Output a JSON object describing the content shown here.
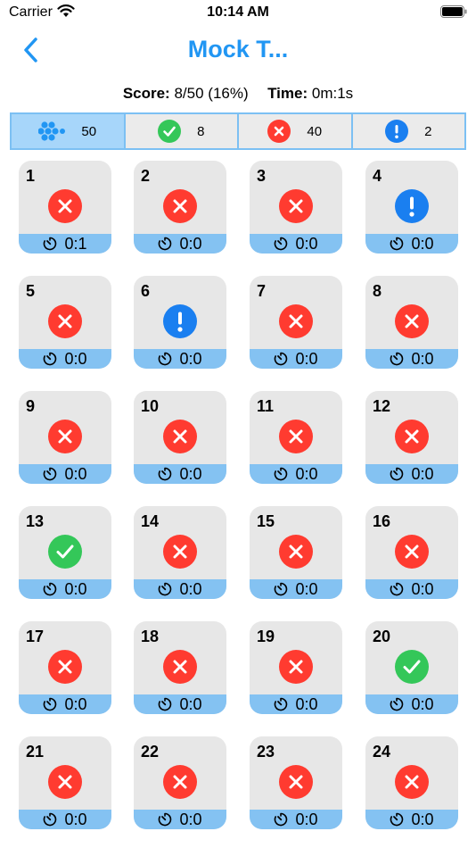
{
  "status_bar": {
    "carrier": "Carrier",
    "time": "10:14 AM"
  },
  "nav": {
    "title": "Mock T..."
  },
  "summary": {
    "score_label": "Score:",
    "score_value": "8/50 (16%)",
    "time_label": "Time:",
    "time_value": "0m:1s"
  },
  "filters": [
    {
      "icon": "all-dots-icon",
      "count": "50",
      "active": true
    },
    {
      "icon": "correct-icon",
      "count": "8",
      "active": false
    },
    {
      "icon": "wrong-icon",
      "count": "40",
      "active": false
    },
    {
      "icon": "skipped-icon",
      "count": "2",
      "active": false
    }
  ],
  "colors": {
    "accent": "#2196f3",
    "correct": "#34c759",
    "wrong": "#ff3b30",
    "skipped": "#1a7ff0",
    "card_bg": "#e7e7e7",
    "card_footer": "#84c2f2"
  },
  "questions": [
    {
      "number": "1",
      "status": "wrong",
      "time": "0:1"
    },
    {
      "number": "2",
      "status": "wrong",
      "time": "0:0"
    },
    {
      "number": "3",
      "status": "wrong",
      "time": "0:0"
    },
    {
      "number": "4",
      "status": "skipped",
      "time": "0:0"
    },
    {
      "number": "5",
      "status": "wrong",
      "time": "0:0"
    },
    {
      "number": "6",
      "status": "skipped",
      "time": "0:0"
    },
    {
      "number": "7",
      "status": "wrong",
      "time": "0:0"
    },
    {
      "number": "8",
      "status": "wrong",
      "time": "0:0"
    },
    {
      "number": "9",
      "status": "wrong",
      "time": "0:0"
    },
    {
      "number": "10",
      "status": "wrong",
      "time": "0:0"
    },
    {
      "number": "11",
      "status": "wrong",
      "time": "0:0"
    },
    {
      "number": "12",
      "status": "wrong",
      "time": "0:0"
    },
    {
      "number": "13",
      "status": "correct",
      "time": "0:0"
    },
    {
      "number": "14",
      "status": "wrong",
      "time": "0:0"
    },
    {
      "number": "15",
      "status": "wrong",
      "time": "0:0"
    },
    {
      "number": "16",
      "status": "wrong",
      "time": "0:0"
    },
    {
      "number": "17",
      "status": "wrong",
      "time": "0:0"
    },
    {
      "number": "18",
      "status": "wrong",
      "time": "0:0"
    },
    {
      "number": "19",
      "status": "wrong",
      "time": "0:0"
    },
    {
      "number": "20",
      "status": "correct",
      "time": "0:0"
    },
    {
      "number": "21",
      "status": "wrong",
      "time": "0:0"
    },
    {
      "number": "22",
      "status": "wrong",
      "time": "0:0"
    },
    {
      "number": "23",
      "status": "wrong",
      "time": "0:0"
    },
    {
      "number": "24",
      "status": "wrong",
      "time": "0:0"
    }
  ]
}
